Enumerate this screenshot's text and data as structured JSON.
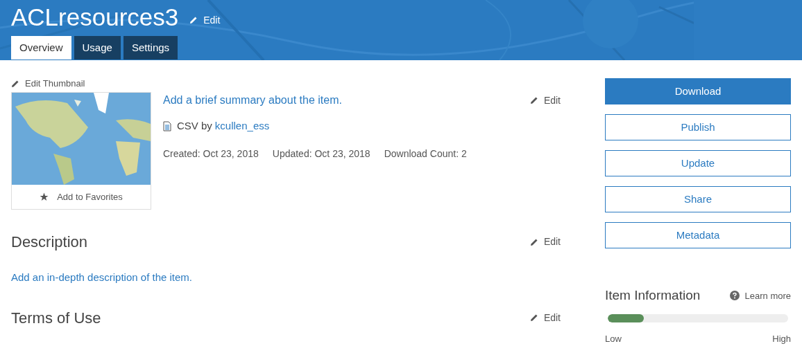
{
  "header": {
    "title": "ACLresources3",
    "edit": "Edit"
  },
  "tabs": [
    {
      "label": "Overview",
      "selected": true
    },
    {
      "label": "Usage",
      "selected": false
    },
    {
      "label": "Settings",
      "selected": false
    }
  ],
  "thumbnail": {
    "edit": "Edit Thumbnail",
    "favorites": "Add to Favorites"
  },
  "summary": {
    "text": "Add a brief summary about the item.",
    "edit": "Edit",
    "type": "CSV",
    "by": "by",
    "owner": "kcullen_ess",
    "created": "Created: Oct 23, 2018",
    "updated": "Updated: Oct 23, 2018",
    "downloads": "Download Count: 2"
  },
  "sections": [
    {
      "title": "Description",
      "edit": "Edit",
      "link": "Add an in-depth description of the item."
    },
    {
      "title": "Terms of Use",
      "edit": "Edit"
    }
  ],
  "actions": [
    {
      "label": "Download",
      "primary": true
    },
    {
      "label": "Publish",
      "primary": false
    },
    {
      "label": "Update",
      "primary": false
    },
    {
      "label": "Share",
      "primary": false
    },
    {
      "label": "Metadata",
      "primary": false
    }
  ],
  "item_information": {
    "title": "Item Information",
    "learn_more": "Learn more",
    "level": 0.2,
    "low": "Low",
    "high": "High"
  }
}
